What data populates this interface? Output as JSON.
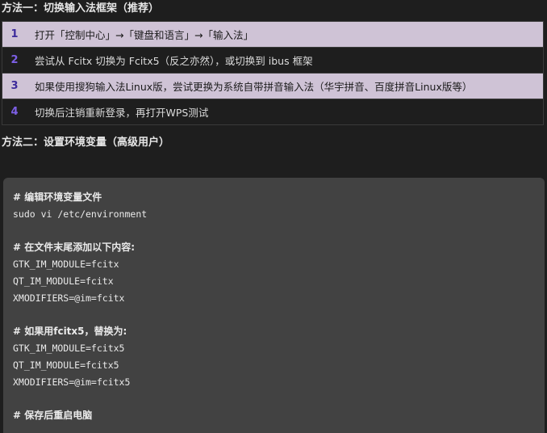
{
  "method1": {
    "title": "方法一：切换输入法框架（推荐）",
    "steps": [
      {
        "num": "1",
        "text": "打开「控制中心」→「键盘和语言」→「输入法」"
      },
      {
        "num": "2",
        "text": "尝试从 Fcitx 切换为 Fcitx5（反之亦然），或切换到 ibus 框架"
      },
      {
        "num": "3",
        "text": "如果使用搜狗输入法Linux版，尝试更换为系统自带拼音输入法（华宇拼音、百度拼音Linux版等）"
      },
      {
        "num": "4",
        "text": "切换后注销重新登录，再打开WPS测试"
      }
    ]
  },
  "method2": {
    "title": "方法二：设置环境变量（高级用户）"
  },
  "code": {
    "lines": [
      "# 编辑环境变量文件",
      "sudo vi /etc/environment",
      "",
      "# 在文件末尾添加以下内容:",
      "GTK_IM_MODULE=fcitx",
      "QT_IM_MODULE=fcitx",
      "XMODIFIERS=@im=fcitx",
      "",
      "# 如果用fcitx5，替换为:",
      "GTK_IM_MODULE=fcitx5",
      "QT_IM_MODULE=fcitx5",
      "XMODIFIERS=@im=fcitx5",
      "",
      "# 保存后重启电脑"
    ]
  }
}
